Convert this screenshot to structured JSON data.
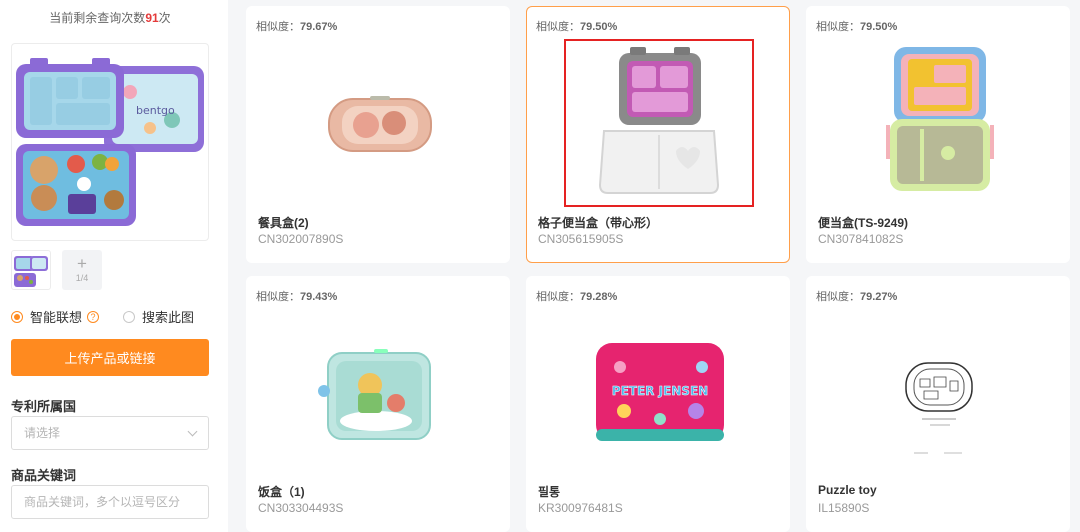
{
  "sidebar": {
    "quota": {
      "prefix": "当前剩余查询次数",
      "count": "91",
      "suffix": "次"
    },
    "add_image": {
      "plus": "+",
      "count": "1/4"
    },
    "radio_smart": "智能联想",
    "radio_search": "搜索此图",
    "upload_button": "上传产品或链接",
    "country_label": "专利所属国",
    "country_placeholder": "请选择",
    "keyword_label": "商品关键词",
    "keyword_placeholder": "商品关键词，多个以逗号区分",
    "product_image_brand": "bentgo"
  },
  "accent_color": "#ff8a1f",
  "results": [
    {
      "similarity_label": "相似度：",
      "similarity": "79.67%",
      "title": "餐具盒(2)",
      "code": "CN302007890S",
      "image_icon": "bento-box-pink-icon"
    },
    {
      "similarity_label": "相似度：",
      "similarity": "79.50%",
      "title": "格子便当盒（带心形）",
      "code": "CN305615905S",
      "image_icon": "bento-box-heart-icon",
      "selected": true
    },
    {
      "similarity_label": "相似度：",
      "similarity": "79.50%",
      "title": "便当盒(TS-9249)",
      "code": "CN307841082S",
      "image_icon": "bento-box-open-icon"
    },
    {
      "similarity_label": "相似度：",
      "similarity": "79.43%",
      "title": "饭盒（1)",
      "code": "CN303304493S",
      "image_icon": "lunch-box-teal-icon"
    },
    {
      "similarity_label": "相似度：",
      "similarity": "79.28%",
      "title": "필통",
      "code": "KR300976481S",
      "image_icon": "pencil-case-icon",
      "image_text": "PETER JENSEN"
    },
    {
      "similarity_label": "相似度：",
      "similarity": "79.27%",
      "title": "Puzzle toy",
      "code": "IL15890S",
      "image_icon": "puzzle-toy-sketch-icon"
    }
  ]
}
